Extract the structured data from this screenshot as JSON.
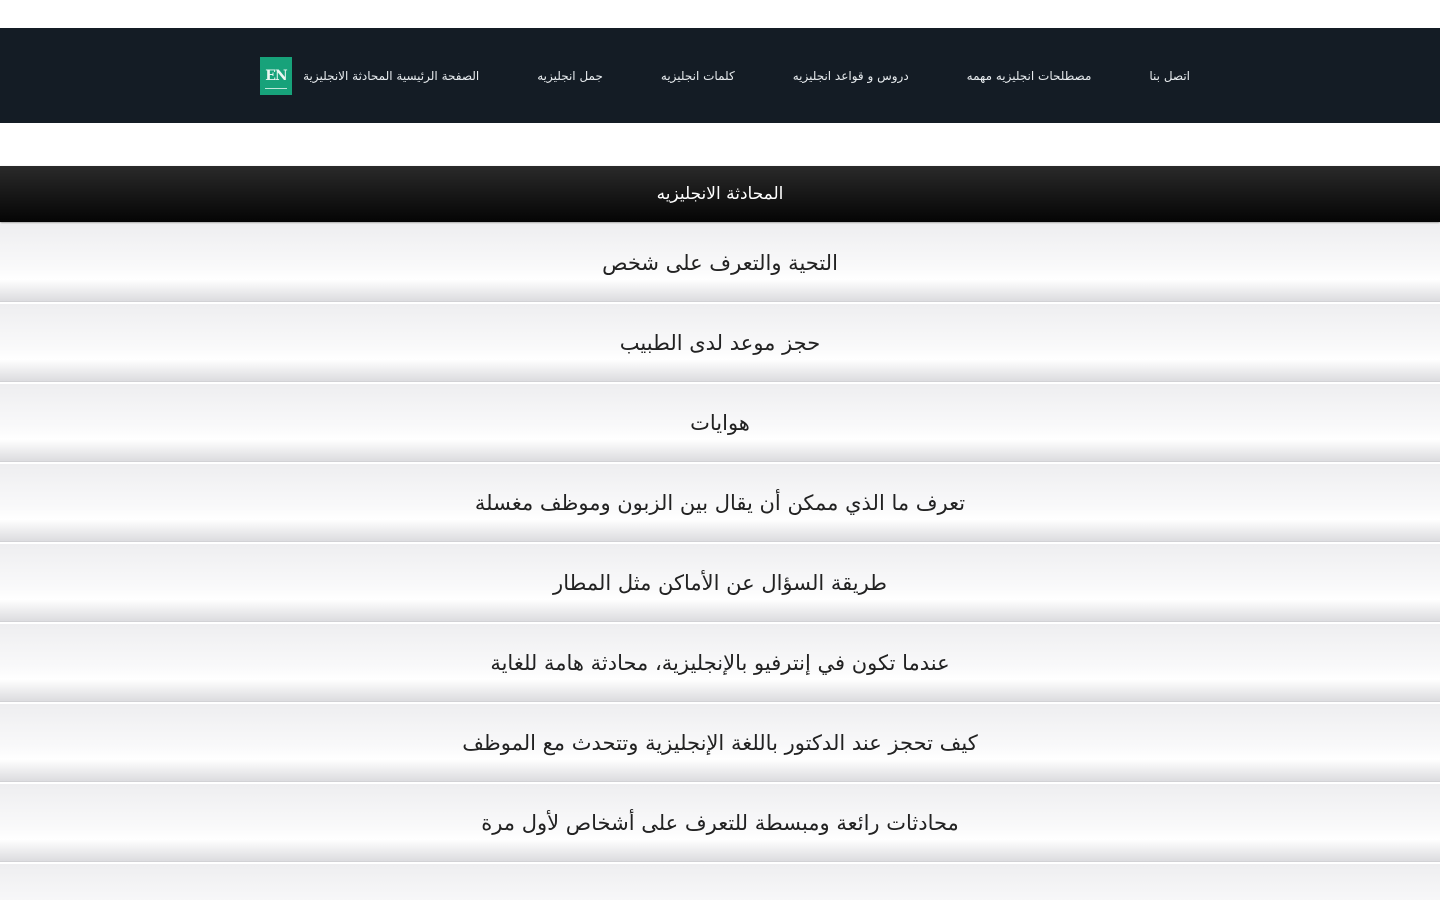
{
  "nav": {
    "logo_text": "EN",
    "links": [
      "الصفحة الرئيسية المحادثة الانجليزية",
      "جمل انجليزيه",
      "كلمات انجليزيه",
      "دروس و قواعد انجليزيه",
      "مصطلحات انجليزيه مهمه",
      "اتصل بنا"
    ]
  },
  "section": {
    "title": "المحادثة الانجليزيه"
  },
  "conversations": [
    "التحية والتعرف على شخص",
    "حجز موعد لدى الطبيب",
    "هوايات",
    "تعرف ما الذي ممكن أن يقال بين الزبون وموظف مغسلة",
    "طريقة السؤال عن الأماكن مثل المطار",
    "عندما تكون في إنترفيو بالإنجليزية، محادثة هامة للغاية",
    "كيف تحجز عند الدكتور باللغة الإنجليزية وتتحدث مع الموظف",
    "محادثات رائعة ومبسطة للتعرف على أشخاص لأول مرة",
    ""
  ],
  "colors": {
    "navbar_bg": "#141c25",
    "logo_bg": "#17a27a",
    "header_bg": "#050505"
  }
}
